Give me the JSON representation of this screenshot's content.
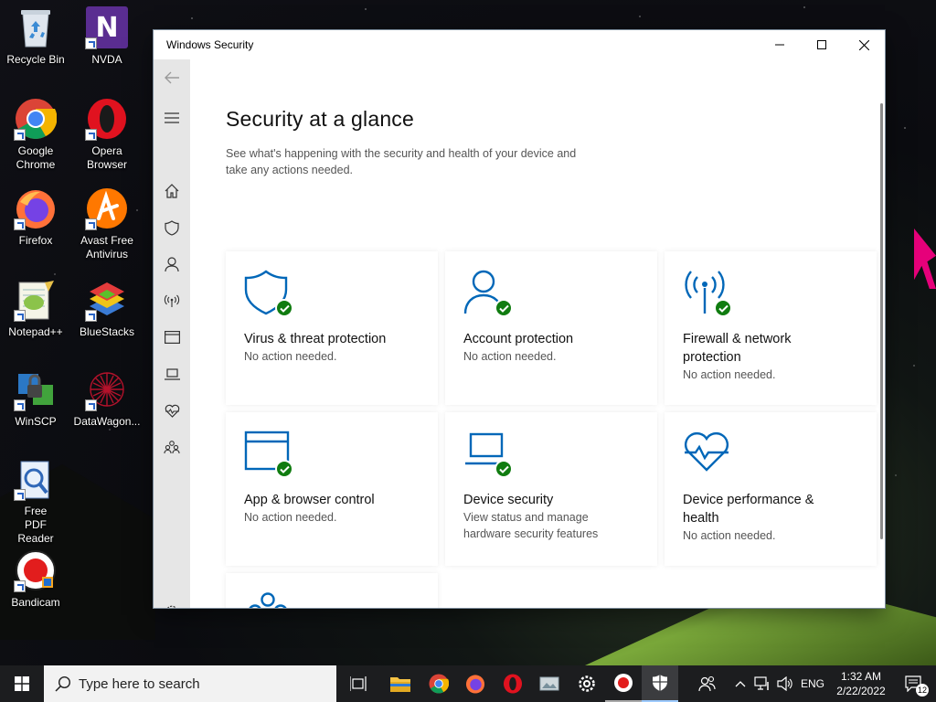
{
  "desktop": {
    "icons": [
      {
        "label": "Recycle Bin"
      },
      {
        "label": "NVDA"
      },
      {
        "label": "Google Chrome"
      },
      {
        "label": "Opera Browser"
      },
      {
        "label": "Firefox"
      },
      {
        "label": "Avast Free Antivirus"
      },
      {
        "label": "Notepad++"
      },
      {
        "label": "BlueStacks"
      },
      {
        "label": "WinSCP"
      },
      {
        "label": "DataWagon..."
      },
      {
        "label": "Free PDF Reader"
      },
      {
        "label": "Bandicam"
      }
    ]
  },
  "window": {
    "title": "Windows Security",
    "page_title": "Security at a glance",
    "subtitle": "See what's happening with the security and health of your device and take any actions needed.",
    "tiles": [
      {
        "name": "Virus & threat protection",
        "status": "No action needed.",
        "icon": "shield-icon"
      },
      {
        "name": "Account protection",
        "status": "No action needed.",
        "icon": "person-icon"
      },
      {
        "name": "Firewall & network protection",
        "status": "No action needed.",
        "icon": "antenna-icon"
      },
      {
        "name": "App & browser control",
        "status": "No action needed.",
        "icon": "browser-window-icon"
      },
      {
        "name": "Device security",
        "status": "View status and manage hardware security features",
        "icon": "laptop-icon"
      },
      {
        "name": "Device performance & health",
        "status": "No action needed.",
        "icon": "heart-pulse-icon"
      },
      {
        "name": "",
        "status": "",
        "icon": "family-icon"
      }
    ],
    "accent_color": "#0067b8",
    "ok_color": "#107c10"
  },
  "taskbar": {
    "search_placeholder": "Type here to search",
    "language": "ENG",
    "time": "1:32 AM",
    "date": "2/22/2022",
    "notification_count": "12"
  }
}
